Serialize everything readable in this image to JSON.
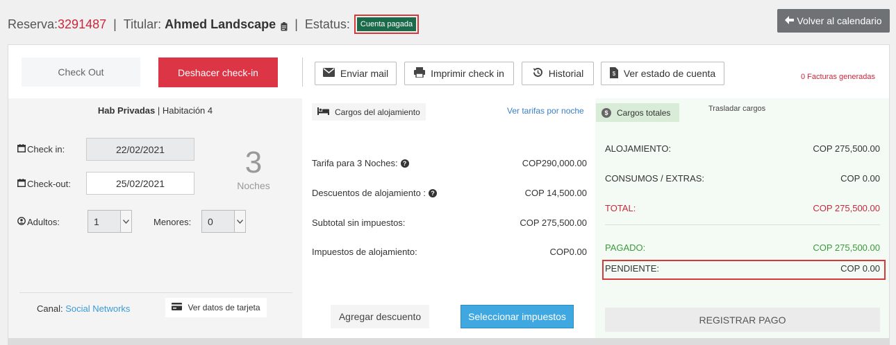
{
  "header": {
    "reserva_label": "Reserva:",
    "reserva_number": "3291487",
    "sep": "|",
    "titular_label": "Titular:",
    "titular_name": "Ahmed Landscape",
    "estatus_label": "Estatus:",
    "status_badge": "Cuenta pagada",
    "back_button": "Volver al calendario"
  },
  "actions": {
    "check_out": "Check Out",
    "undo_checkin": "Deshacer check-in",
    "send_mail": "Enviar mail",
    "print_checkin": "Imprimir check in",
    "history": "Historial",
    "account_status": "Ver estado de cuenta",
    "invoices": "0 Facturas generadas"
  },
  "room": {
    "type": "Hab Privadas",
    "divider": "|",
    "name": "Habitación 4",
    "checkin_label": "Check in:",
    "checkin_value": "22/02/2021",
    "checkout_label": "Check-out:",
    "checkout_value": "25/02/2021",
    "nights_count": "3",
    "nights_label": "Noches",
    "adults_label": "Adultos:",
    "adults_value": "1",
    "minors_label": "Menores:",
    "minors_value": "0",
    "channel_label": "Canal:",
    "channel_value": "Social Networks",
    "card_data_button": "Ver datos de tarjeta"
  },
  "lodging": {
    "tab_label": "Cargos del alojamiento",
    "rates_link": "Ver tarifas por noche",
    "rows": [
      {
        "label": "Tarifa para 3 Noches:",
        "value": "COP290,000.00"
      },
      {
        "label": "Descuentos de alojamiento :",
        "value": "COP 14,500.00"
      },
      {
        "label": "Subtotal sin impuestos:",
        "value": "COP 275,500.00"
      },
      {
        "label": "Impuestos de alojamiento:",
        "value": "COP0.00"
      }
    ],
    "discount_button": "Agregar descuento",
    "taxes_button": "Seleccionar impuestos"
  },
  "totals": {
    "tab_label": "Cargos totales",
    "transfer_label": "Trasladar cargos",
    "rows": [
      {
        "label": "ALOJAMIENTO:",
        "value": "COP 275,500.00"
      },
      {
        "label": "CONSUMOS / EXTRAS:",
        "value": "COP 0.00"
      },
      {
        "label": "TOTAL:",
        "value": "COP 275,500.00"
      },
      {
        "label": "PAGADO:",
        "value": "COP 275,500.00"
      },
      {
        "label": "PENDIENTE:",
        "value": "COP 0.00"
      }
    ],
    "register_payment": "REGISTRAR PAGO"
  },
  "colors": {
    "danger": "#dc3545",
    "status_green": "#1b6b4a",
    "primary_blue": "#3fa8e0",
    "highlight_red": "#d9383a",
    "paid_green": "#3a9a3a"
  }
}
